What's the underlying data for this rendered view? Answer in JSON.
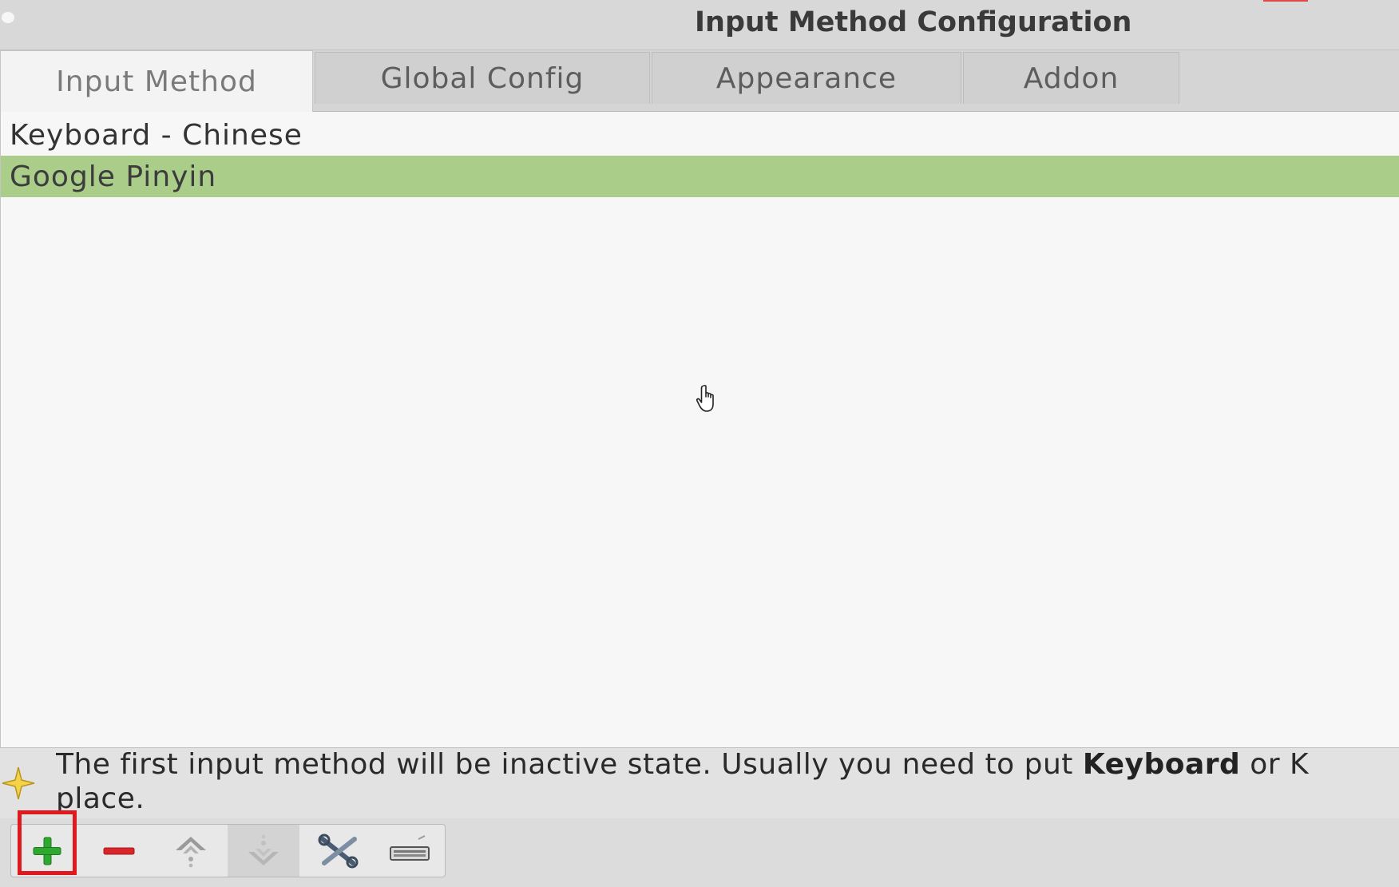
{
  "window": {
    "title": "Input Method Configuration"
  },
  "tabs": [
    {
      "label": "Input Method",
      "active": true
    },
    {
      "label": "Global Config",
      "active": false
    },
    {
      "label": "Appearance",
      "active": false
    },
    {
      "label": "Addon",
      "active": false
    }
  ],
  "input_methods": [
    {
      "label": "Keyboard - Chinese",
      "selected": false
    },
    {
      "label": "Google Pinyin",
      "selected": true
    }
  ],
  "hint": {
    "text_before": "The first input method will be inactive state. Usually you need to put ",
    "bold": "Keyboard",
    "text_after": " or K",
    "line2": "place."
  },
  "toolbar": {
    "buttons": [
      {
        "name": "add-input-method-button",
        "icon": "plus-icon",
        "enabled": true
      },
      {
        "name": "remove-input-method-button",
        "icon": "minus-icon",
        "enabled": true
      },
      {
        "name": "move-up-button",
        "icon": "arrow-up-icon",
        "enabled": true
      },
      {
        "name": "move-down-button",
        "icon": "arrow-down-icon",
        "enabled": false
      },
      {
        "name": "configure-input-method-button",
        "icon": "tools-icon",
        "enabled": true
      },
      {
        "name": "keyboard-layout-button",
        "icon": "keyboard-icon",
        "enabled": true
      }
    ]
  },
  "colors": {
    "selected_row": "#abcd8a",
    "highlight": "#e0191f",
    "add_icon": "#2fa82f",
    "remove_icon": "#d8262b"
  }
}
